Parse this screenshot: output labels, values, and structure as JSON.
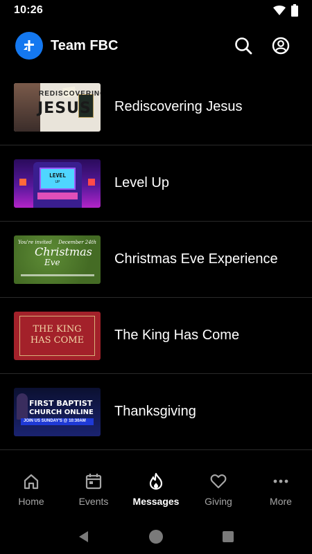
{
  "status_bar": {
    "time": "10:26"
  },
  "app_bar": {
    "title": "Team FBC"
  },
  "messages": [
    {
      "title": "Rediscovering Jesus",
      "thumb_text": [
        "REDISCOVERING",
        "JESUS"
      ]
    },
    {
      "title": "Level Up",
      "thumb_text": [
        "LEVEL",
        "UP"
      ]
    },
    {
      "title": "Christmas Eve Experience",
      "thumb_text": [
        "You're invited",
        "December 24th",
        "Christmas",
        "Eve"
      ]
    },
    {
      "title": "The King Has Come",
      "thumb_text": [
        "THE KING",
        "HAS COME"
      ]
    },
    {
      "title": "Thanksgiving",
      "thumb_text": [
        "FIRST BAPTIST",
        "CHURCH ONLINE",
        "JOIN US SUNDAY'S @ 10:30AM"
      ]
    }
  ],
  "bottom_nav": [
    {
      "label": "Home",
      "icon": "home-icon",
      "active": false
    },
    {
      "label": "Events",
      "icon": "calendar-icon",
      "active": false
    },
    {
      "label": "Messages",
      "icon": "flame-icon",
      "active": true
    },
    {
      "label": "Giving",
      "icon": "heart-icon",
      "active": false
    },
    {
      "label": "More",
      "icon": "more-icon",
      "active": false
    }
  ]
}
